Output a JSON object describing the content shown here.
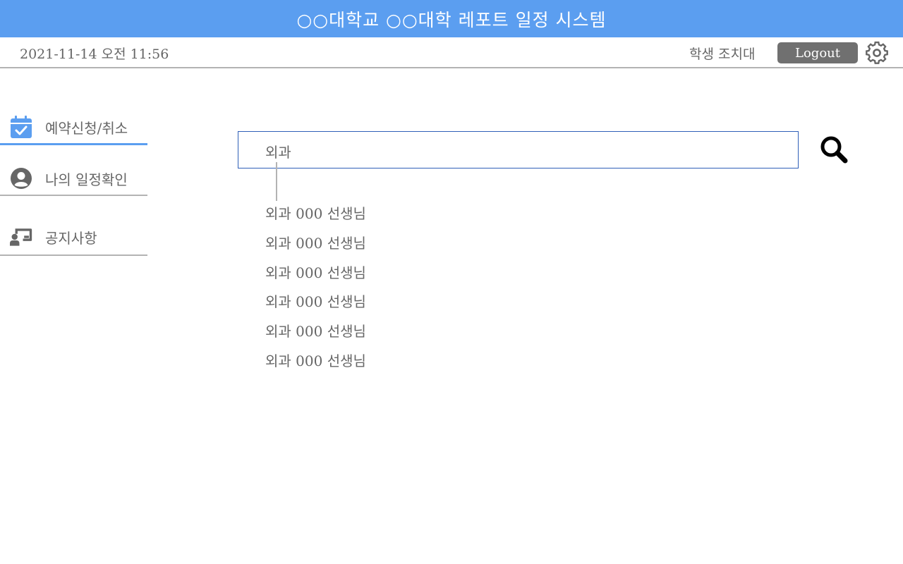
{
  "header": {
    "title": "○○대학교 ○○대학 레포트 일정 시스템"
  },
  "info": {
    "datetime": "2021-11-14 오전 11:56",
    "user": "학생 조치대",
    "logout_label": "Logout",
    "settings_icon": "gear-icon"
  },
  "sidebar": {
    "items": [
      {
        "label": "예약신청/취소",
        "icon": "calendar-check-icon",
        "active": true
      },
      {
        "label": "나의 일정확인",
        "icon": "user-circle-icon",
        "active": false
      },
      {
        "label": "공지사항",
        "icon": "chalkboard-user-icon",
        "active": false
      }
    ]
  },
  "search": {
    "value": "외과",
    "button_icon": "search-icon"
  },
  "suggestions": [
    "외과 000 선생님",
    "외과 000 선생님",
    "외과 000 선생님",
    "외과 000 선생님",
    "외과 000 선생님",
    "외과 000 선생님"
  ],
  "colors": {
    "accent": "#5b9ef0",
    "text": "#666666",
    "button": "#707070",
    "search_border": "#2f5fb8"
  }
}
